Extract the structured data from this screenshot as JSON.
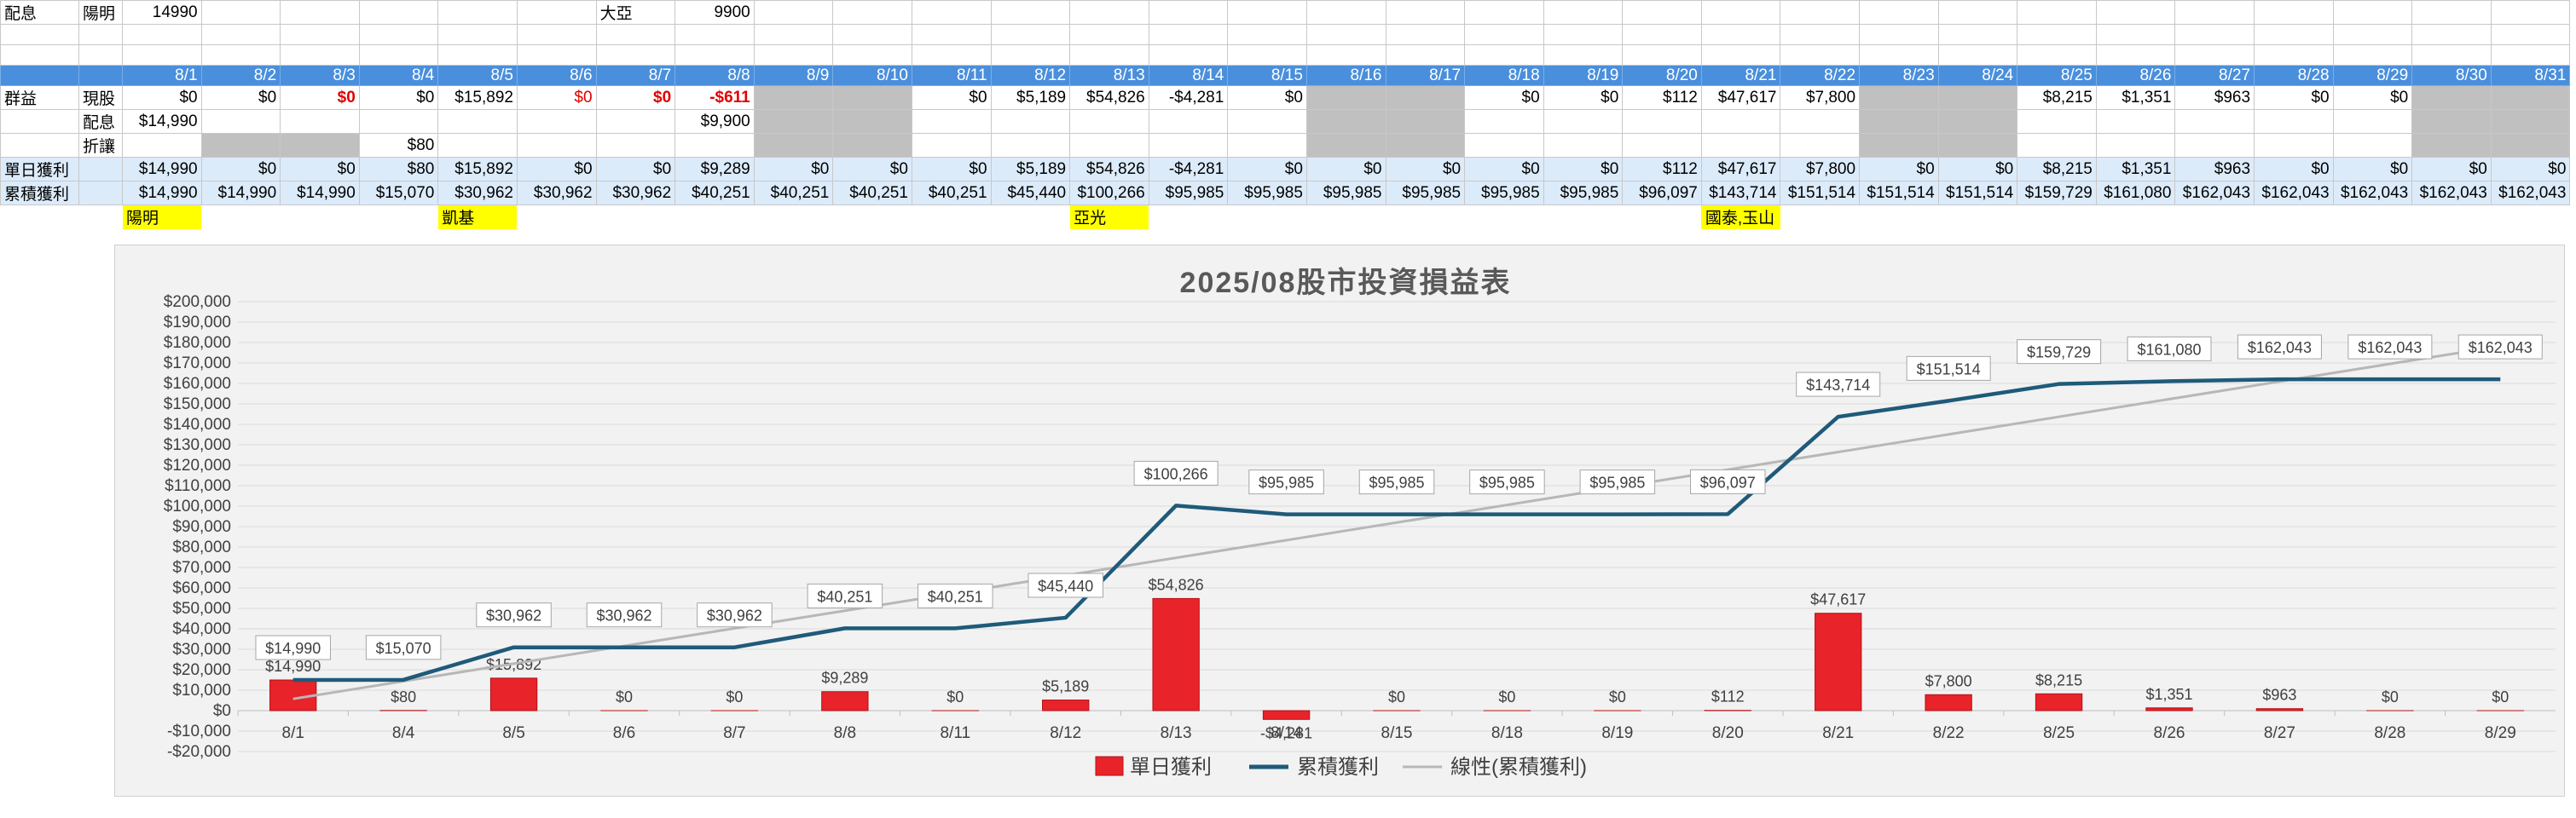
{
  "sheet": {
    "top_row": {
      "label": "配息",
      "stock1": "陽明",
      "amount1": "14990",
      "stock2": "大亞",
      "amount2": "9900"
    },
    "dates": [
      "8/1",
      "8/2",
      "8/3",
      "8/4",
      "8/5",
      "8/6",
      "8/7",
      "8/8",
      "8/9",
      "8/10",
      "8/11",
      "8/12",
      "8/13",
      "8/14",
      "8/15",
      "8/16",
      "8/17",
      "8/18",
      "8/19",
      "8/20",
      "8/21",
      "8/22",
      "8/23",
      "8/24",
      "8/25",
      "8/26",
      "8/27",
      "8/28",
      "8/29",
      "8/30",
      "8/31"
    ],
    "group_label": "群益",
    "row_labels": {
      "spot": "現股",
      "dividend": "配息",
      "discount": "折讓"
    },
    "spot": [
      "$0",
      "$0",
      "$0",
      "$0",
      "$15,892",
      "$0",
      "$0",
      "-$611",
      "",
      "",
      "$0",
      "$5,189",
      "$54,826",
      "-$4,281",
      "$0",
      "",
      "",
      "$0",
      "$0",
      "$112",
      "$47,617",
      "$7,800",
      "",
      "",
      "$8,215",
      "$1,351",
      "$963",
      "$0",
      "$0",
      "",
      ""
    ],
    "dividend": [
      "$14,990",
      "",
      "",
      "",
      "",
      "",
      "",
      "$9,900",
      "",
      "",
      "",
      "",
      "",
      "",
      "",
      "",
      "",
      "",
      "",
      "",
      "",
      "",
      "",
      "",
      "",
      "",
      "",
      "",
      "",
      "",
      ""
    ],
    "discount": [
      "",
      "",
      "",
      "$80",
      "",
      "",
      "",
      "",
      "",
      "",
      "",
      "",
      "",
      "",
      "",
      "",
      "",
      "",
      "",
      "",
      "",
      "",
      "",
      "",
      "",
      "",
      "",
      "",
      "",
      "",
      ""
    ],
    "daily_label": "單日獲利",
    "daily": [
      "$14,990",
      "$0",
      "$0",
      "$80",
      "$15,892",
      "$0",
      "$0",
      "$9,289",
      "$0",
      "$0",
      "$0",
      "$5,189",
      "$54,826",
      "-$4,281",
      "$0",
      "$0",
      "$0",
      "$0",
      "$0",
      "$112",
      "$47,617",
      "$7,800",
      "$0",
      "$0",
      "$8,215",
      "$1,351",
      "$963",
      "$0",
      "$0",
      "$0",
      "$0"
    ],
    "cum_label": "累積獲利",
    "cumulative": [
      "$14,990",
      "$14,990",
      "$14,990",
      "$15,070",
      "$30,962",
      "$30,962",
      "$30,962",
      "$40,251",
      "$40,251",
      "$40,251",
      "$40,251",
      "$45,440",
      "$100,266",
      "$95,985",
      "$95,985",
      "$95,985",
      "$95,985",
      "$95,985",
      "$95,985",
      "$96,097",
      "$143,714",
      "$151,514",
      "$151,514",
      "$151,514",
      "$159,729",
      "$161,080",
      "$162,043",
      "$162,043",
      "$162,043",
      "$162,043",
      "$162,043"
    ],
    "notes": [
      {
        "col": 0,
        "text": "陽明"
      },
      {
        "col": 4,
        "text": "凱基"
      },
      {
        "col": 12,
        "text": "亞光"
      },
      {
        "col": 20,
        "text": "國泰,玉山"
      }
    ]
  },
  "chart_data": {
    "type": "bar",
    "title": "2025/08股市投資損益表",
    "categories": [
      "8/1",
      "8/4",
      "8/5",
      "8/6",
      "8/7",
      "8/8",
      "8/11",
      "8/12",
      "8/13",
      "8/14",
      "8/15",
      "8/18",
      "8/19",
      "8/20",
      "8/21",
      "8/22",
      "8/25",
      "8/26",
      "8/27",
      "8/28",
      "8/29"
    ],
    "series": [
      {
        "name": "單日獲利",
        "type": "bar",
        "color": "#e8232a",
        "values": [
          14990,
          80,
          15892,
          0,
          0,
          9289,
          0,
          5189,
          54826,
          -4281,
          0,
          0,
          0,
          112,
          47617,
          7800,
          8215,
          1351,
          963,
          0,
          0
        ]
      },
      {
        "name": "累積獲利",
        "type": "line",
        "color": "#1f5a7a",
        "values": [
          14990,
          15070,
          30962,
          30962,
          30962,
          40251,
          40251,
          45440,
          100266,
          95985,
          95985,
          95985,
          95985,
          96097,
          143714,
          151514,
          159729,
          161080,
          162043,
          162043,
          162043
        ]
      },
      {
        "name": "線性(累積獲利)",
        "type": "trendline",
        "color": "#b7b7b7"
      }
    ],
    "bar_labels": [
      "$14,990",
      "$80",
      "$15,892",
      "$0",
      "$0",
      "$9,289",
      "$0",
      "$5,189",
      "$54,826",
      "-$4,281",
      "$0",
      "$0",
      "$0",
      "$112",
      "$47,617",
      "$7,800",
      "$8,215",
      "$1,351",
      "$963",
      "$0",
      "$0"
    ],
    "line_labels": [
      "$14,990",
      "$15,070",
      "$30,962",
      "$30,962",
      "$30,962",
      "$40,251",
      "$40,251",
      "$45,440",
      "$100,266",
      "$95,985",
      "$95,985",
      "$95,985",
      "$95,985",
      "$96,097",
      "$143,714",
      "$151,514",
      "$159,729",
      "$161,080",
      "$162,043",
      "$162,043",
      "$162,043"
    ],
    "yticks": [
      "$200,000",
      "$190,000",
      "$180,000",
      "$170,000",
      "$160,000",
      "$150,000",
      "$140,000",
      "$130,000",
      "$120,000",
      "$110,000",
      "$100,000",
      "$90,000",
      "$80,000",
      "$70,000",
      "$60,000",
      "$50,000",
      "$40,000",
      "$30,000",
      "$20,000",
      "$10,000",
      "$0",
      "-$10,000",
      "-$20,000"
    ],
    "ylim": [
      -20000,
      200000
    ],
    "grid": true,
    "legend": "bottom"
  }
}
